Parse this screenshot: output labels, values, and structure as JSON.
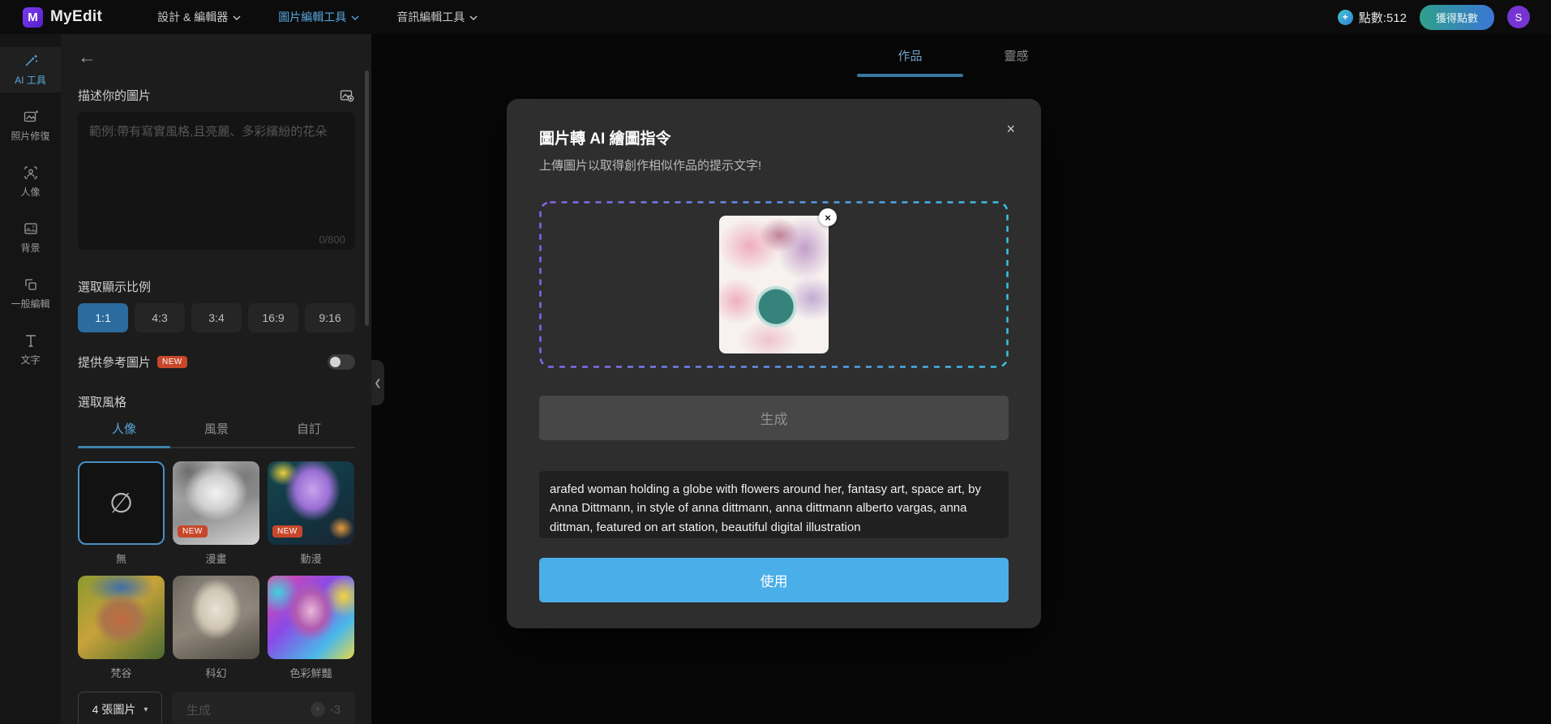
{
  "icons": {
    "close": "×",
    "back": "←",
    "none_style": "∅",
    "caret": "▾",
    "plus": "+",
    "collapse": "❮"
  },
  "colors": {
    "accent_blue": "#58a7dd",
    "primary_button": "#4aaee8",
    "active_ratio": "#2c6b9d",
    "new_badge": "#c8472b",
    "credits_gradient": [
      "#2fa08b",
      "#3b76d6"
    ],
    "dropzone_gradient": [
      "#8a63f2",
      "#39c2e8"
    ]
  },
  "navbar": {
    "logo_mark": "M",
    "logo_text": "MyEdit",
    "menus": [
      {
        "label": "設計 & 編輯器"
      },
      {
        "label": "圖片編輯工具"
      },
      {
        "label": "音訊編輯工具"
      }
    ],
    "credits_label": "點數:512",
    "get_credits_button": "獲得點數",
    "avatar_initial": "S"
  },
  "sidebar": {
    "items": [
      {
        "label": "AI 工具"
      },
      {
        "label": "照片修復"
      },
      {
        "label": "人像"
      },
      {
        "label": "背景"
      },
      {
        "label": "一般編輯"
      },
      {
        "label": "文字"
      }
    ]
  },
  "panel": {
    "describe_label": "描述你的圖片",
    "textarea_placeholder": "範例:帶有寫實風格,且亮麗、多彩繽紛的花朵",
    "char_counter": "0/800",
    "ratio_label": "選取顯示比例",
    "ratios": [
      {
        "label": "1:1"
      },
      {
        "label": "4:3"
      },
      {
        "label": "3:4"
      },
      {
        "label": "16:9"
      },
      {
        "label": "9:16"
      }
    ],
    "reference_label": "提供參考圖片",
    "new_badge": "NEW",
    "style_label": "選取風格",
    "style_tabs": [
      {
        "label": "人像"
      },
      {
        "label": "風景"
      },
      {
        "label": "自訂"
      }
    ],
    "styles": [
      {
        "label": "無"
      },
      {
        "label": "漫畫",
        "badge": "NEW"
      },
      {
        "label": "動漫",
        "badge": "NEW"
      },
      {
        "label": "梵谷"
      },
      {
        "label": "科幻"
      },
      {
        "label": "色彩鮮豔"
      }
    ],
    "count_dropdown": "4 張圖片",
    "generate_label": "生成",
    "generate_cost": "-3"
  },
  "workspace": {
    "tabs": [
      {
        "label": "作品"
      },
      {
        "label": "靈感"
      }
    ]
  },
  "modal": {
    "title": "圖片轉 AI 繪圖指令",
    "subtitle": "上傳圖片以取得創作相似作品的提示文字!",
    "generate_label": "生成",
    "prompt_text": "arafed woman holding a globe with flowers around her, fantasy art, space art, by Anna Dittmann, in style of anna dittmann, anna dittmann alberto vargas, anna dittman, featured on art station, beautiful digital illustration",
    "use_button": "使用"
  }
}
